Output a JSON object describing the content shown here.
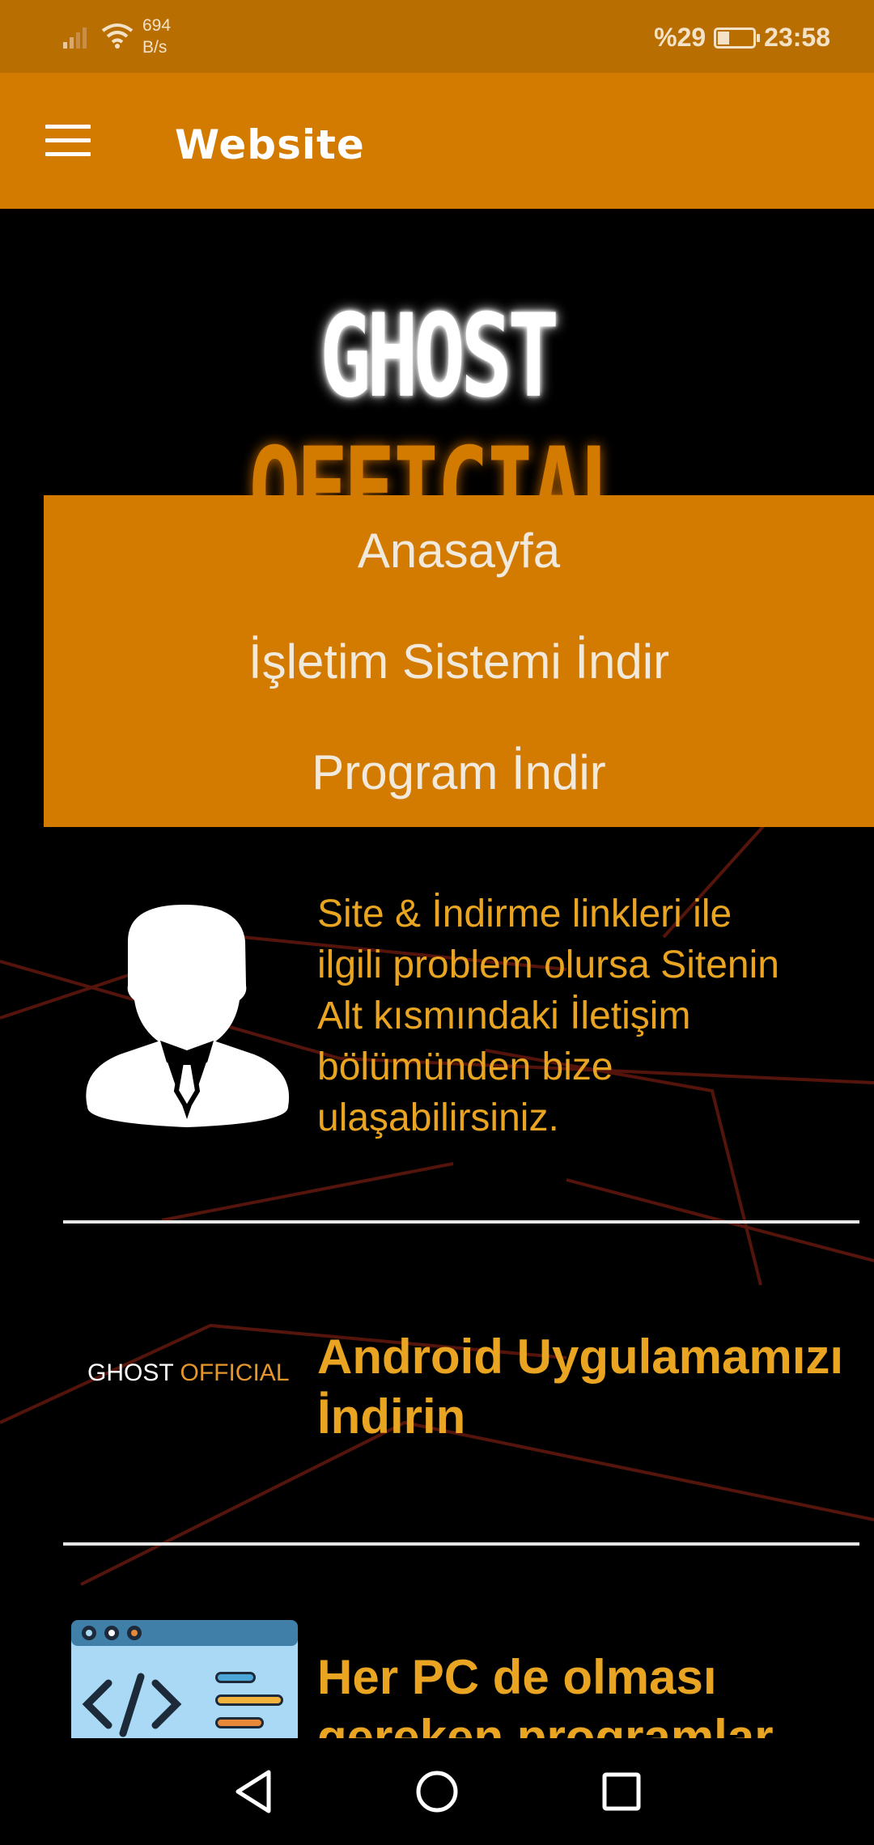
{
  "status_bar": {
    "net_speed_value": "694",
    "net_speed_unit": "B/s",
    "battery": "%29",
    "time": "23:58",
    "icons": [
      "signal-icon",
      "wifi-icon",
      "battery-icon"
    ]
  },
  "app_bar": {
    "title": "Website",
    "menu_icon": "hamburger-icon"
  },
  "logo": {
    "word1": "GHOST",
    "word2": "OFFICIAL"
  },
  "menu": {
    "items": [
      {
        "label": "Anasayfa"
      },
      {
        "label": "İşletim Sistemi İndir"
      },
      {
        "label": "Program İndir"
      }
    ]
  },
  "info": {
    "lines": [
      "Site & İndirme linkleri ile",
      "ilgili problem olursa Sitenin",
      "Alt kısmındaki İletişim",
      "bölümünden bize",
      "ulaşabilirsiniz."
    ]
  },
  "android": {
    "mini_logo_word1": "GHOST",
    "mini_logo_word2": "OFFICIAL",
    "line1": "Android Uygulamamızı",
    "line2": "İndirin"
  },
  "pc": {
    "line1": "Her PC de olması",
    "line2": "gereken programlar"
  },
  "colors": {
    "accent": "#d37a00",
    "status_bar": "#b86e00",
    "text_accent": "#e9a521"
  }
}
